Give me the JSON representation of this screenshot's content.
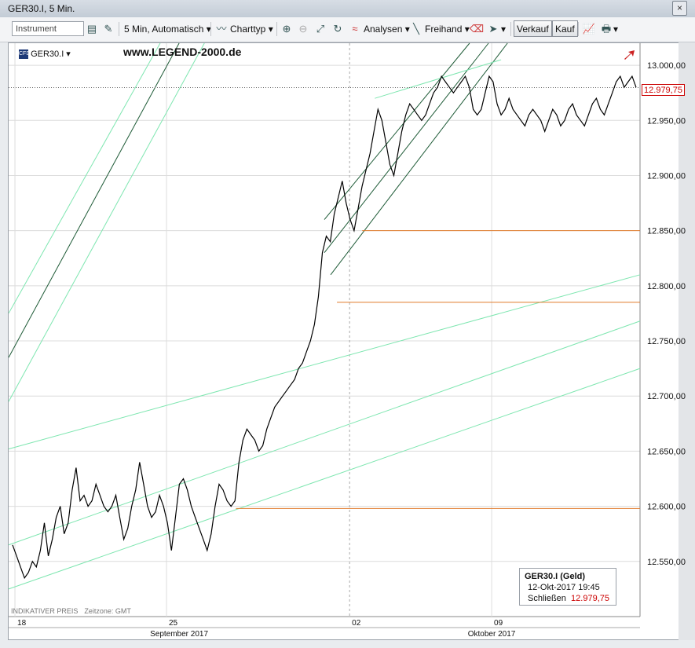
{
  "window": {
    "title": "GER30.I, 5 Min."
  },
  "toolbar": {
    "instrument_placeholder": "Instrument",
    "interval": "5 Min, Automatisch",
    "charttype": "Charttyp",
    "analysen": "Analysen",
    "freihand": "Freihand",
    "verkauf": "Verkauf",
    "kauf": "Kauf"
  },
  "header": {
    "instrument": "GER30.I",
    "website": "www.LEGEND-2000.de"
  },
  "footer": {
    "indikativ": "INDIKATIVER PREIS",
    "zeitzone": "Zeitzone: GMT"
  },
  "infobox": {
    "title": "GER30.I (Geld)",
    "datetime": "12-Okt-2017 19:45",
    "close_label": "Schließen",
    "close_value": "12.979,75"
  },
  "current_price": "12.979,75",
  "colors": {
    "price": "#000000",
    "support": "#e07a2a",
    "channel_light": "#7ee6b0",
    "channel_dark": "#1d5a36",
    "current": "#cc0000"
  },
  "chart_data": {
    "type": "line",
    "title": "GER30.I, 5 Min.",
    "ylim": [
      12500,
      13020
    ],
    "yticks": [
      12550,
      12600,
      12650,
      12700,
      12750,
      12800,
      12850,
      12900,
      12950,
      13000
    ],
    "ytick_labels": [
      "12.550,00",
      "12.600,00",
      "12.650,00",
      "12.700,00",
      "12.750,00",
      "12.800,00",
      "12.850,00",
      "12.900,00",
      "12.950,00",
      "13.000,00"
    ],
    "x_labels": [
      "18",
      "25",
      "02",
      "09"
    ],
    "month_labels": [
      "September 2017",
      "Oktober 2017"
    ],
    "series": [
      {
        "values": [
          12565,
          12555,
          12545,
          12535,
          12540,
          12550,
          12545,
          12560,
          12585,
          12555,
          12570,
          12590,
          12600,
          12575,
          12585,
          12615,
          12635,
          12605,
          12610,
          12600,
          12605,
          12620,
          12610,
          12600,
          12595,
          12600,
          12610,
          12590,
          12570,
          12580,
          12600,
          12615,
          12640,
          12620,
          12600,
          12590,
          12595,
          12610,
          12600,
          12585,
          12560,
          12590,
          12620,
          12625,
          12615,
          12600,
          12590,
          12580,
          12570,
          12560,
          12575,
          12600,
          12620,
          12615,
          12605,
          12600,
          12605,
          12640,
          12660,
          12670,
          12665,
          12660,
          12650,
          12655,
          12670,
          12680,
          12690,
          12695,
          12700,
          12705,
          12710,
          12715,
          12725,
          12730,
          12740,
          12750,
          12765,
          12790,
          12830,
          12845,
          12840,
          12865,
          12880,
          12895,
          12875,
          12860,
          12850,
          12870,
          12890,
          12905,
          12920,
          12940,
          12960,
          12950,
          12930,
          12910,
          12900,
          12920,
          12940,
          12955,
          12965,
          12960,
          12955,
          12950,
          12955,
          12965,
          12975,
          12980,
          12990,
          12985,
          12980,
          12975,
          12980,
          12985,
          12990,
          12980,
          12960,
          12955,
          12960,
          12975,
          12990,
          12985,
          12965,
          12955,
          12960,
          12970,
          12960,
          12955,
          12950,
          12945,
          12955,
          12960,
          12955,
          12950,
          12940,
          12950,
          12960,
          12955,
          12945,
          12950,
          12960,
          12965,
          12955,
          12950,
          12945,
          12955,
          12965,
          12970,
          12960,
          12955,
          12965,
          12975,
          12985,
          12990,
          12980,
          12985,
          12990,
          12980
        ]
      }
    ],
    "horizontal_lines": [
      12850,
      12785,
      12598
    ],
    "channel_light_lines": [
      {
        "from": [
          0,
          12652
        ],
        "to": [
          1,
          12810
        ]
      },
      {
        "from": [
          0,
          12565
        ],
        "to": [
          1,
          12768
        ]
      },
      {
        "from": [
          0,
          12525
        ],
        "to": [
          1,
          12725
        ]
      }
    ]
  }
}
